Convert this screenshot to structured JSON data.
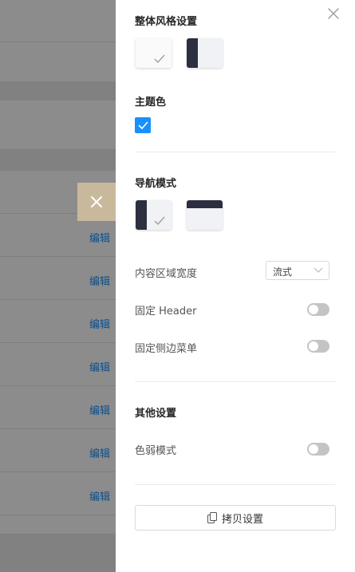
{
  "background": {
    "edit_links": [
      "编辑",
      "编辑",
      "编辑",
      "编辑",
      "编辑",
      "编辑",
      "编辑"
    ]
  },
  "drawer": {
    "sections": {
      "overall_style": {
        "title": "整体风格设置"
      },
      "theme_color": {
        "title": "主题色",
        "selected_color": "#1890ff"
      },
      "nav_mode": {
        "title": "导航模式"
      },
      "content_width": {
        "label": "内容区域宽度",
        "selected": "流式"
      },
      "fixed_header": {
        "label": "固定 Header"
      },
      "fixed_sidebar": {
        "label": "固定侧边菜单"
      },
      "other": {
        "title": "其他设置"
      },
      "color_weak": {
        "label": "色弱模式"
      }
    },
    "copy_button": {
      "label": "拷贝设置"
    }
  }
}
